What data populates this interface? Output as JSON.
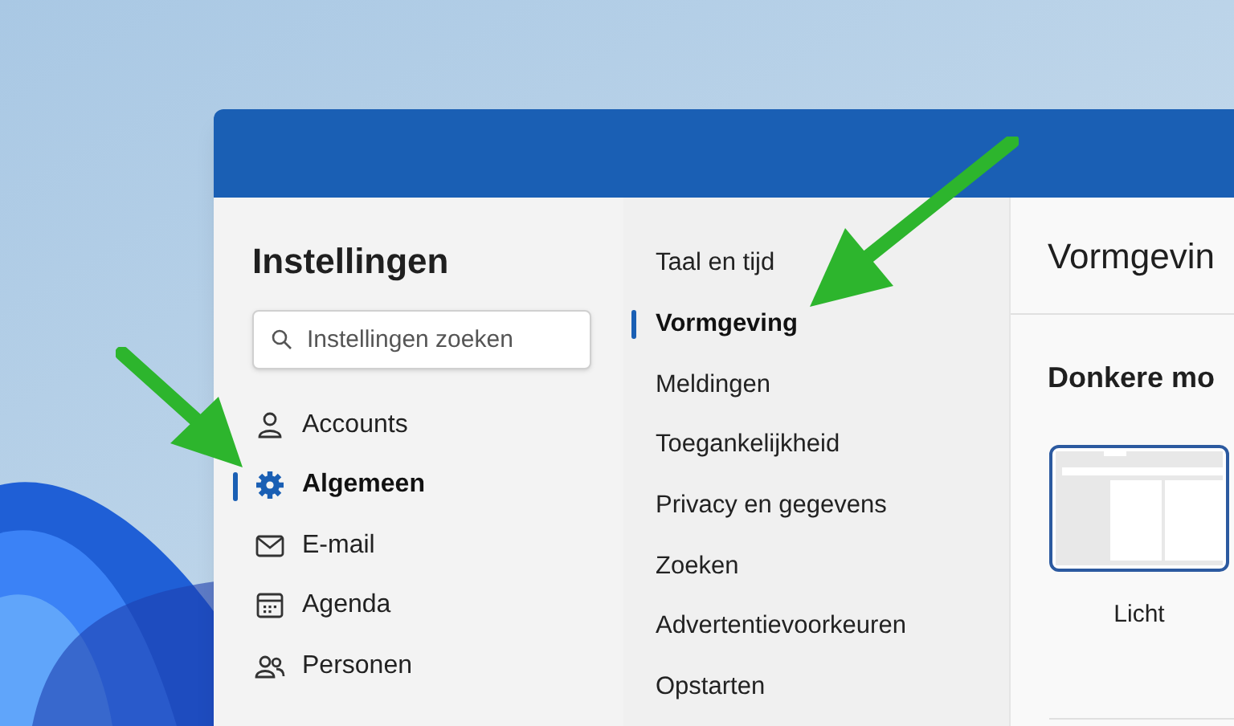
{
  "sidebar": {
    "title": "Instellingen",
    "search": {
      "placeholder": "Instellingen zoeken"
    },
    "items": [
      {
        "label": "Accounts",
        "kind": "person",
        "selected": false
      },
      {
        "label": "Algemeen",
        "kind": "gear",
        "selected": true
      },
      {
        "label": "E-mail",
        "kind": "mail",
        "selected": false
      },
      {
        "label": "Agenda",
        "kind": "calendar",
        "selected": false
      },
      {
        "label": "Personen",
        "kind": "people",
        "selected": false
      }
    ]
  },
  "subnav": [
    {
      "label": "Taal en tijd",
      "selected": false
    },
    {
      "label": "Vormgeving",
      "selected": true
    },
    {
      "label": "Meldingen",
      "selected": false
    },
    {
      "label": "Toegankelijkheid",
      "selected": false
    },
    {
      "label": "Privacy en gegevens",
      "selected": false
    },
    {
      "label": "Zoeken",
      "selected": false
    },
    {
      "label": "Advertentievoorkeuren",
      "selected": false
    },
    {
      "label": "Opstarten",
      "selected": false
    }
  ],
  "content": {
    "heading": "Vormgevin",
    "section": "Donkere mo",
    "themes": [
      {
        "label": "Licht",
        "selected": true
      }
    ]
  }
}
